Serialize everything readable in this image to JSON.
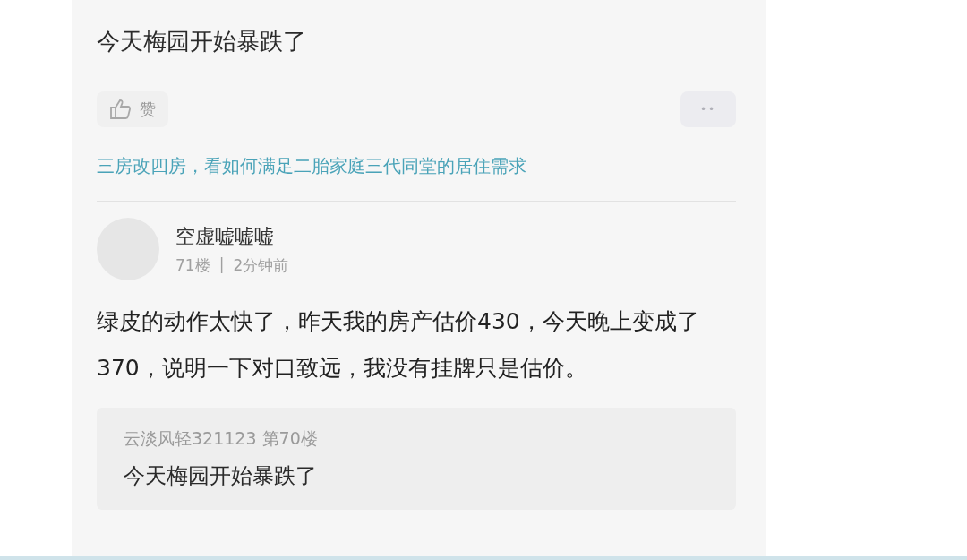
{
  "post": {
    "text": "今天梅园开始暴跌了",
    "like_label": "赞",
    "more_label": "••"
  },
  "promo_link": "三房改四房，看如何满足二胎家庭三代同堂的居住需求",
  "reply": {
    "username": "空虚嘘嘘嘘",
    "floor": "71楼",
    "separator": "|",
    "time": "2分钟前",
    "text": "绿皮的动作太快了，昨天我的房产估价430，今天晚上变成了370，说明一下对口致远，我没有挂牌只是估价。",
    "quote": {
      "author": "云淡风轻321123",
      "floor": "第70楼",
      "text": "今天梅园开始暴跌了"
    }
  }
}
